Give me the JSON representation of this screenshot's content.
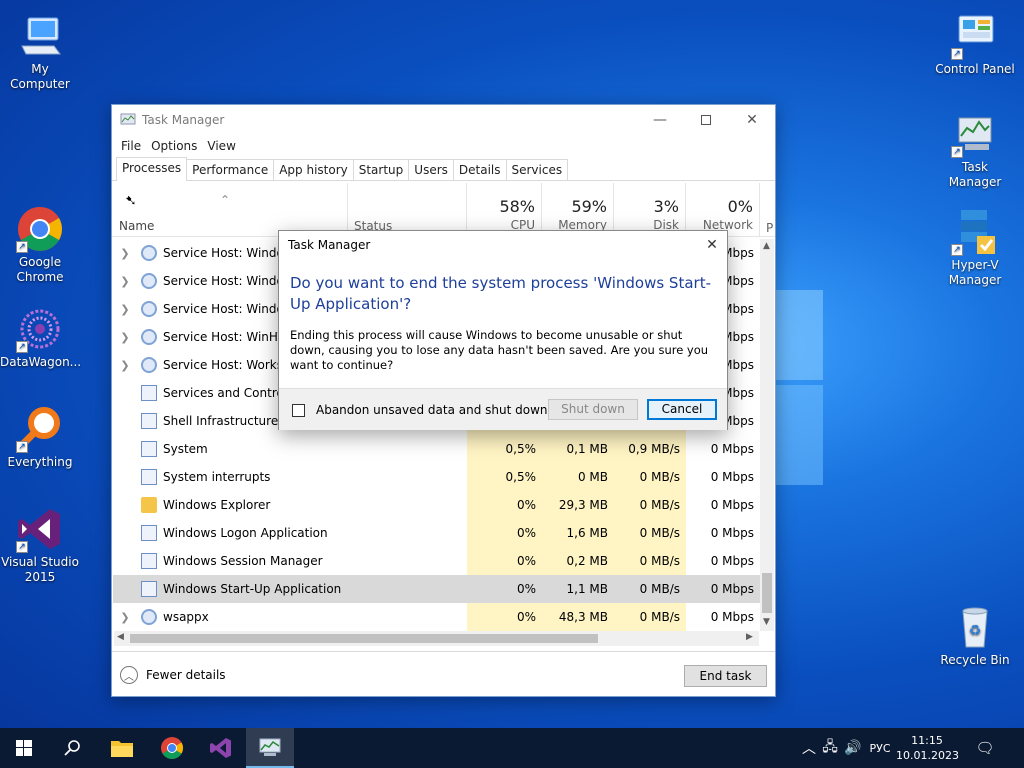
{
  "desktop": {
    "icons": {
      "my_computer": "My Computer",
      "chrome": "Google Chrome",
      "datawagon": "DataWagon...",
      "everything": "Everything",
      "vs": "Visual Studio 2015",
      "control_panel": "Control Panel",
      "task_manager": "Task Manager",
      "hyperv": "Hyper-V Manager",
      "recycle": "Recycle Bin"
    }
  },
  "window": {
    "title": "Task Manager",
    "menu": [
      "File",
      "Options",
      "View"
    ],
    "tabs": [
      "Processes",
      "Performance",
      "App history",
      "Startup",
      "Users",
      "Details",
      "Services"
    ],
    "active_tab": "Processes",
    "columns": {
      "name": "Name",
      "status": "Status",
      "cpu": {
        "pct": "58%",
        "label": "CPU"
      },
      "memory": {
        "pct": "59%",
        "label": "Memory"
      },
      "disk": {
        "pct": "3%",
        "label": "Disk"
      },
      "network": {
        "pct": "0%",
        "label": "Network"
      },
      "power_cut": "P"
    },
    "rows": [
      {
        "name": "Service Host: Windows Font Cache Service",
        "expand": true,
        "icon": "gear",
        "cpu": "",
        "mem": "",
        "disk": "",
        "net": "0 Mbps"
      },
      {
        "name": "Service Host: Windows Image Acquisition",
        "expand": true,
        "icon": "gear",
        "cpu": "",
        "mem": "",
        "disk": "",
        "net": "0 Mbps"
      },
      {
        "name": "Service Host: Windows Update",
        "expand": true,
        "icon": "gear",
        "cpu": "",
        "mem": "",
        "disk": "",
        "net": "0 Mbps"
      },
      {
        "name": "Service Host: WinHTTP Web Proxy",
        "expand": true,
        "icon": "gear",
        "cpu": "",
        "mem": "",
        "disk": "",
        "net": "0 Mbps"
      },
      {
        "name": "Service Host: Workstation",
        "expand": true,
        "icon": "gear",
        "cpu": "",
        "mem": "",
        "disk": "",
        "net": "0 Mbps"
      },
      {
        "name": "Services and Controller app",
        "expand": false,
        "icon": "app",
        "cpu": "",
        "mem": "",
        "disk": "",
        "net": "0 Mbps"
      },
      {
        "name": "Shell Infrastructure Host",
        "expand": false,
        "icon": "app",
        "cpu": "",
        "mem": "",
        "disk": "",
        "net": "0 Mbps"
      },
      {
        "name": "System",
        "expand": false,
        "icon": "app",
        "cpu": "0,5%",
        "mem": "0,1 MB",
        "disk": "0,9 MB/s",
        "net": "0 Mbps"
      },
      {
        "name": "System interrupts",
        "expand": false,
        "icon": "app",
        "cpu": "0,5%",
        "mem": "0 MB",
        "disk": "0 MB/s",
        "net": "0 Mbps"
      },
      {
        "name": "Windows Explorer",
        "expand": false,
        "icon": "folder",
        "cpu": "0%",
        "mem": "29,3 MB",
        "disk": "0 MB/s",
        "net": "0 Mbps"
      },
      {
        "name": "Windows Logon Application",
        "expand": false,
        "icon": "app",
        "cpu": "0%",
        "mem": "1,6 MB",
        "disk": "0 MB/s",
        "net": "0 Mbps"
      },
      {
        "name": "Windows Session Manager",
        "expand": false,
        "icon": "app",
        "cpu": "0%",
        "mem": "0,2 MB",
        "disk": "0 MB/s",
        "net": "0 Mbps"
      },
      {
        "name": "Windows Start-Up Application",
        "expand": false,
        "icon": "app",
        "cpu": "0%",
        "mem": "1,1 MB",
        "disk": "0 MB/s",
        "net": "0 Mbps",
        "selected": true
      },
      {
        "name": "wsappx",
        "expand": true,
        "icon": "gear",
        "cpu": "0%",
        "mem": "48,3 MB",
        "disk": "0 MB/s",
        "net": "0 Mbps"
      }
    ],
    "fewer_details": "Fewer details",
    "end_task": "End task"
  },
  "dialog": {
    "title": "Task Manager",
    "heading": "Do you want to end the system process 'Windows Start-Up Application'?",
    "body": "Ending this process will cause Windows to become unusable or shut down, causing you to lose any data hasn't been saved. Are you sure you want to continue?",
    "checkbox_label": "Abandon unsaved data and shut down.",
    "checkbox_checked": false,
    "shutdown_label": "Shut down",
    "cancel_label": "Cancel"
  },
  "taskbar": {
    "language": "РУС",
    "time": "11:15",
    "date": "10.01.2023"
  }
}
